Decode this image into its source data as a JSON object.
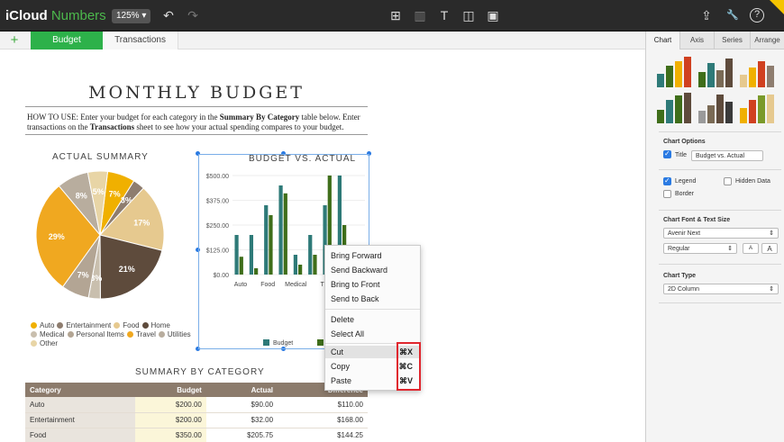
{
  "app": {
    "brand": "iCloud",
    "name": "Numbers",
    "zoom": "125% ▾"
  },
  "toolbar": {
    "undo_icon": "↶",
    "redo_icon": "↷",
    "table_icon": "⊞",
    "chart_icon": "▥",
    "text_icon": "T",
    "shape_icon": "◫",
    "media_icon": "▣",
    "share_icon": "⇪",
    "wrench_icon": "🔧",
    "help_icon": "?"
  },
  "sheets": {
    "add": "+",
    "tabs": [
      "Budget",
      "Transactions"
    ]
  },
  "doc": {
    "title": "MONTHLY BUDGET",
    "instr_prefix": "HOW TO USE: Enter your budget for each category in the ",
    "instr_bold1": "Summary By Category",
    "instr_mid": " table below. Enter transactions on the ",
    "instr_bold2": "Transactions",
    "instr_suffix": " sheet to see how your actual spending compares to your budget."
  },
  "pie": {
    "title": "ACTUAL SUMMARY",
    "slices": [
      {
        "label": "Auto",
        "value": 7,
        "color": "#f0b000"
      },
      {
        "label": "Entertainment",
        "value": 3,
        "color": "#8e7d6f"
      },
      {
        "label": "Food",
        "value": 17,
        "color": "#e6c98f"
      },
      {
        "label": "Home",
        "value": 21,
        "color": "#5e4b3c"
      },
      {
        "label": "Medical",
        "value": 3,
        "color": "#c9bfae"
      },
      {
        "label": "Personal Items",
        "value": 7,
        "color": "#b3a594"
      },
      {
        "label": "Travel",
        "value": 29,
        "color": "#f0a820"
      },
      {
        "label": "Utilities",
        "value": 8,
        "color": "#b8ad9e"
      },
      {
        "label": "Other",
        "value": 5,
        "color": "#e8d5a6"
      }
    ],
    "slice_labels": [
      "7%",
      "3%",
      "17%",
      "21%",
      "3%",
      "7%",
      "29%",
      "8%",
      "5%"
    ]
  },
  "legend": [
    "Auto",
    "Entertainment",
    "Food",
    "Home",
    "Medical",
    "Personal Items",
    "Travel",
    "Utilities",
    "Other"
  ],
  "chart_data": {
    "type": "bar",
    "title": "BUDGET VS. ACTUAL",
    "xlabel": "",
    "ylabel": "",
    "ylim": [
      0,
      500
    ],
    "yticks": [
      "$500.00",
      "$375.00",
      "$250.00",
      "$125.00",
      "$0.00"
    ],
    "categories": [
      "Auto",
      "Entertainment",
      "Food",
      "Home",
      "Medical",
      "Personal Items",
      "Travel",
      "Utilities",
      "Other"
    ],
    "category_labels_shown": [
      "Auto",
      "Food",
      "Medical",
      "T"
    ],
    "series": [
      {
        "name": "Budget",
        "color": "#2e7a78",
        "values": [
          200,
          200,
          350,
          450,
          100,
          200,
          350,
          500,
          150
        ]
      },
      {
        "name": "Actual",
        "color": "#3f6e1a",
        "values": [
          90,
          32,
          300,
          410,
          50,
          100,
          500,
          250,
          50
        ]
      }
    ],
    "legend_position": "bottom"
  },
  "context_menu": {
    "items": [
      "Bring Forward",
      "Send Backward",
      "Bring to Front",
      "Send to Back",
      "Delete",
      "Select All",
      "Cut",
      "Copy",
      "Paste"
    ],
    "shortcuts": [
      "⌘X",
      "⌘C",
      "⌘V"
    ]
  },
  "summary": {
    "title": "SUMMARY BY CATEGORY",
    "headers": [
      "Category",
      "Budget",
      "Actual",
      "Difference"
    ],
    "rows": [
      [
        "Auto",
        "$200.00",
        "$90.00",
        "$110.00"
      ],
      [
        "Entertainment",
        "$200.00",
        "$32.00",
        "$168.00"
      ],
      [
        "Food",
        "$350.00",
        "$205.75",
        "$144.25"
      ]
    ]
  },
  "panel": {
    "tabs": [
      "Chart",
      "Axis",
      "Series",
      "Arrange"
    ],
    "chart_options": "Chart Options",
    "title_label": "Title",
    "title_value": "Budget vs. Actual",
    "legend_label": "Legend",
    "hidden_data_label": "Hidden Data",
    "border_label": "Border",
    "font_heading": "Chart Font & Text Size",
    "font_value": "Avenir Next",
    "style_value": "Regular",
    "font_small": "A",
    "font_large": "A",
    "chart_type_heading": "Chart Type",
    "chart_type_value": "2D Column",
    "thumb_colors": [
      [
        "#2e7a78",
        "#3f6e1a",
        "#f0b000",
        "#d04020"
      ],
      [
        "#3f6e1a",
        "#2e7a78",
        "#7a6a55",
        "#5e4b3c"
      ],
      [
        "#e6c98f",
        "#f0b000",
        "#d04020",
        "#8e7d6f"
      ],
      [
        "#3f6e1a",
        "#2e7a78",
        "#3f6e1a",
        "#5e4b3c"
      ],
      [
        "#9a9a9a",
        "#7a6a55",
        "#5e4b3c",
        "#3a3a3a"
      ],
      [
        "#f0b000",
        "#d04020",
        "#7a9a2a",
        "#e6c98f"
      ]
    ]
  }
}
